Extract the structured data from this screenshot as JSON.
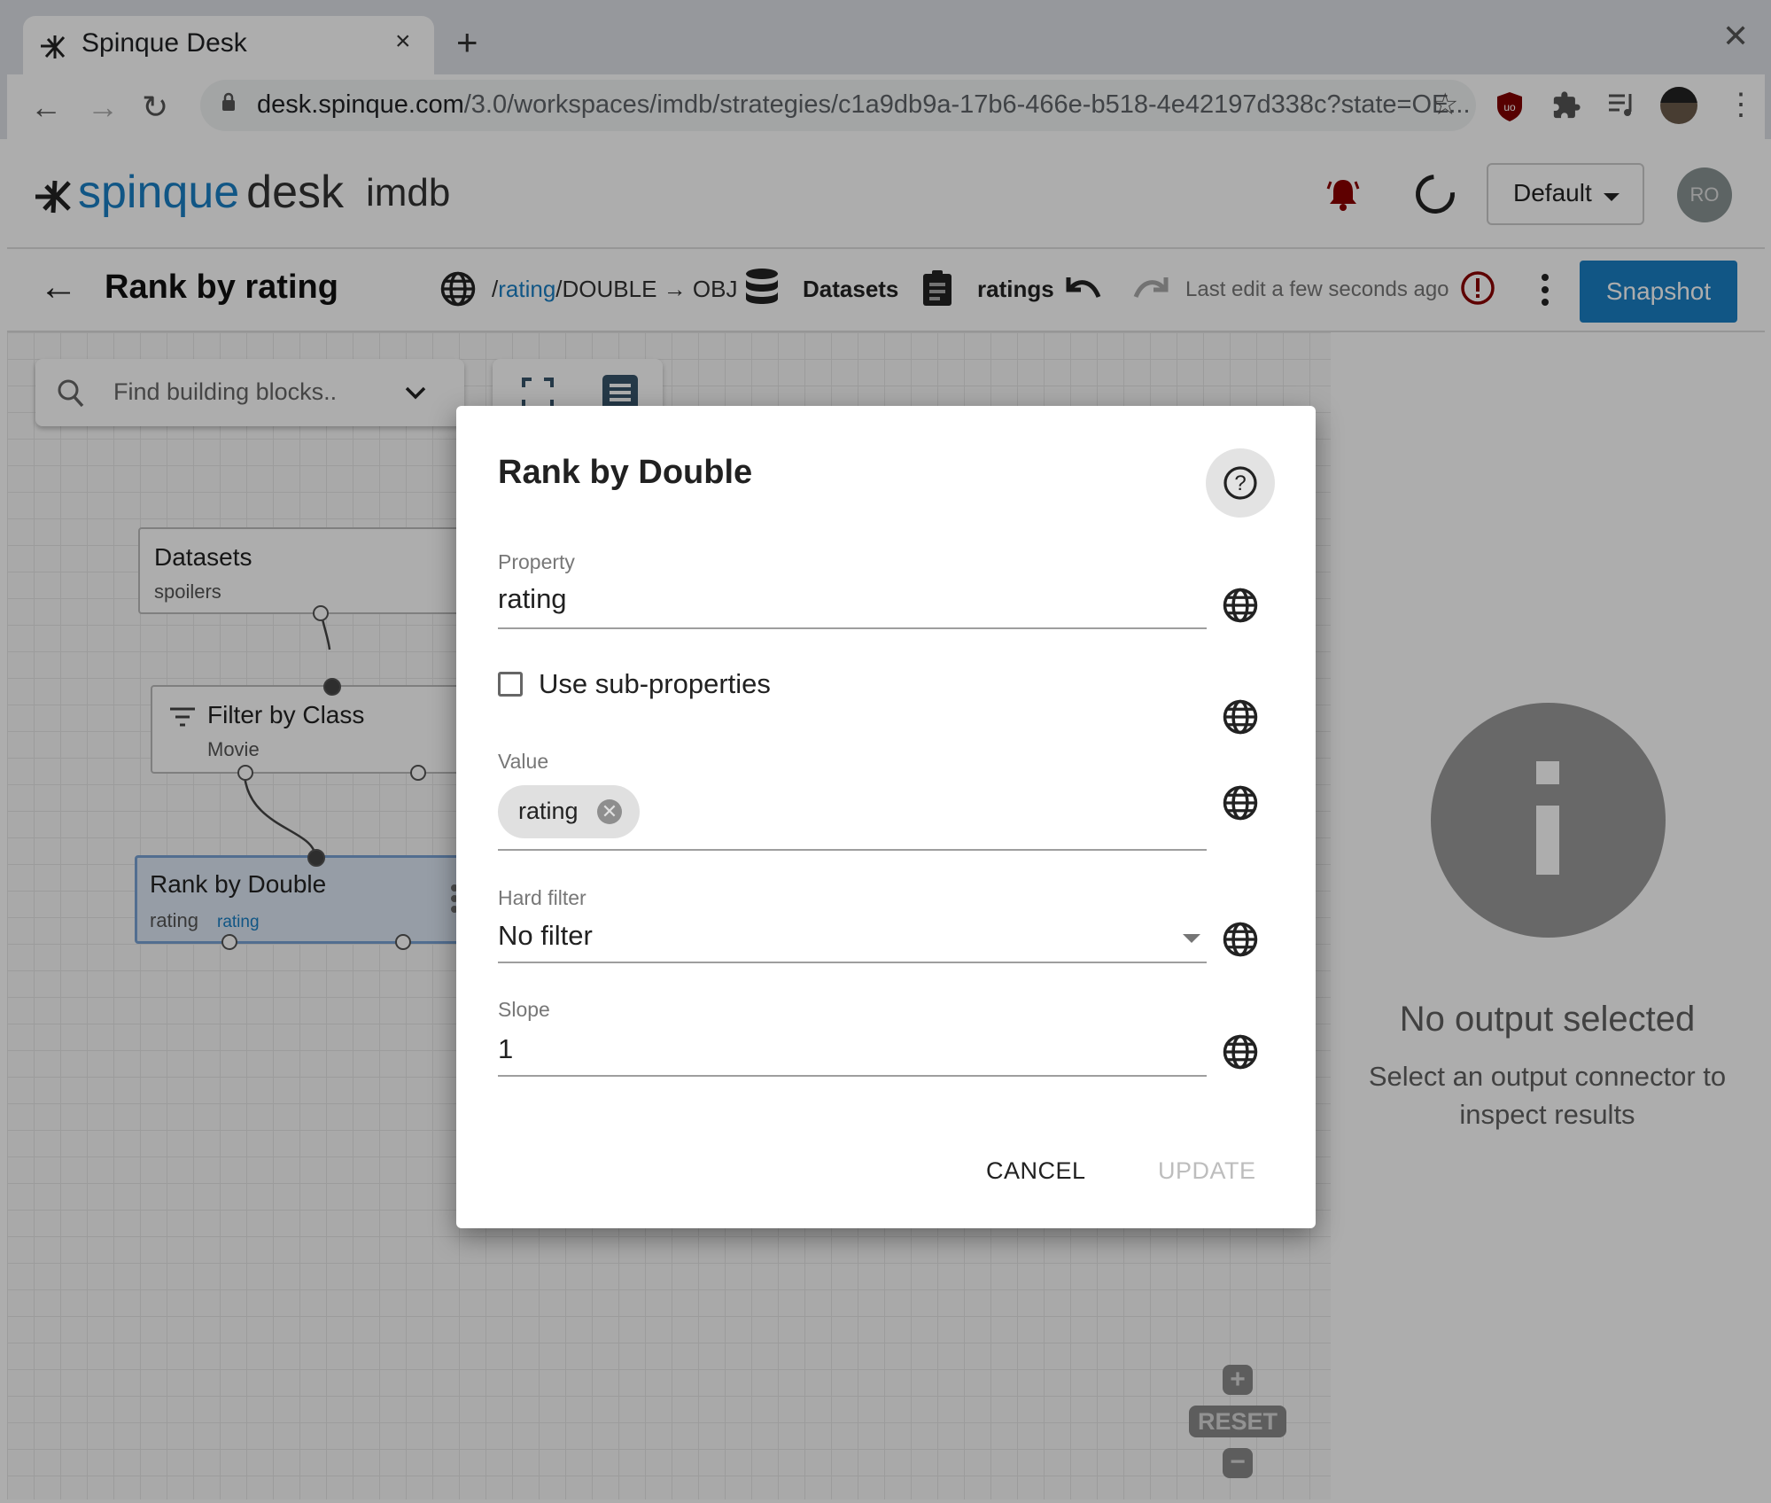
{
  "browser": {
    "tab_title": "Spinque Desk",
    "tab_close": "×",
    "new_tab": "+",
    "window_close": "✕",
    "url_host": "desk.spinque.com",
    "url_path": "/3.0/workspaces/imdb/strategies/c1a9db9a-17b6-466e-b518-4e42197d338c?state=OE...",
    "nav": {
      "back": "←",
      "forward": "→",
      "reload": "↻"
    },
    "star": "☆",
    "menu": "⋮"
  },
  "app": {
    "logo_spinque": "spinque",
    "logo_desk": "desk",
    "workspace": "imdb",
    "environment_select": "Default",
    "avatar_initials": "RO",
    "accent_color": "#1a7fc4"
  },
  "subheader": {
    "back": "←",
    "title": "Rank by rating",
    "path_prefix": "/",
    "path_property": "rating",
    "path_type": "/DOUBLE → OBJ",
    "datasets_label": "Datasets",
    "ratings_label": "ratings",
    "last_edit": "Last edit a few seconds ago",
    "snapshot_button": "Snapshot"
  },
  "canvas": {
    "search_placeholder": "Find building blocks..",
    "nodes": [
      {
        "title": "Datasets",
        "subtitle": "spoilers"
      },
      {
        "title": "Filter by Class",
        "subtitle": "Movie"
      },
      {
        "title": "Rank by Double",
        "subtitle": "rating",
        "subtitle_link": "rating"
      }
    ],
    "zoom_in": "+",
    "zoom_reset": "RESET",
    "zoom_out": "−"
  },
  "dialog": {
    "title": "Rank by Double",
    "help": "?",
    "property_label": "Property",
    "property_value": "rating",
    "use_sub_properties_label": "Use sub-properties",
    "use_sub_properties_checked": false,
    "value_label": "Value",
    "value_chip": "rating",
    "chip_remove": "✕",
    "hard_filter_label": "Hard filter",
    "hard_filter_value": "No filter",
    "slope_label": "Slope",
    "slope_value": "1",
    "cancel": "CANCEL",
    "update": "UPDATE"
  },
  "right_panel": {
    "title": "No output selected",
    "subtitle": "Select an output connector to inspect results"
  }
}
